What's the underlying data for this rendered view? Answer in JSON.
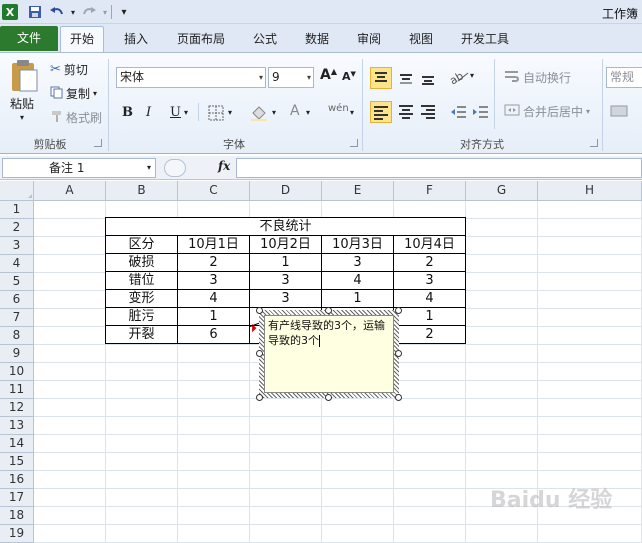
{
  "window": {
    "title": "工作簿"
  },
  "tabs": [
    "文件",
    "开始",
    "插入",
    "页面布局",
    "公式",
    "数据",
    "审阅",
    "视图",
    "开发工具"
  ],
  "ribbon": {
    "clipboard": {
      "paste": "粘贴",
      "cut": "剪切",
      "copy": "复制",
      "format_painter": "格式刷",
      "label": "剪贴板"
    },
    "font": {
      "name": "宋体",
      "size": "9",
      "bold": "B",
      "italic": "I",
      "underline": "U",
      "label": "字体",
      "grow": "A",
      "shrink": "A"
    },
    "alignment": {
      "wrap": "自动换行",
      "merge": "合并后居中",
      "label": "对齐方式"
    },
    "number": {
      "format": "常规"
    }
  },
  "formula_bar": {
    "name_box": "备注 1",
    "fx": "fx",
    "value": ""
  },
  "columns": [
    "A",
    "B",
    "C",
    "D",
    "E",
    "F",
    "G",
    "H"
  ],
  "rows": [
    "1",
    "2",
    "3",
    "4",
    "5",
    "6",
    "7",
    "8",
    "9",
    "10",
    "11",
    "12",
    "13",
    "14",
    "15",
    "16",
    "17",
    "18",
    "19"
  ],
  "table": {
    "title": "不良统计",
    "header": [
      "区分",
      "10月1日",
      "10月2日",
      "10月3日",
      "10月4日"
    ],
    "rows": [
      [
        "破损",
        "2",
        "1",
        "3",
        "2"
      ],
      [
        "错位",
        "3",
        "3",
        "4",
        "3"
      ],
      [
        "变形",
        "4",
        "3",
        "1",
        "4"
      ],
      [
        "脏污",
        "1",
        "",
        "",
        "1"
      ],
      [
        "开裂",
        "6",
        "",
        "",
        "2"
      ]
    ]
  },
  "comment": {
    "text": "有产线导致的3个，运输导致的3个"
  },
  "colors": {
    "file_tab": "#2b7a2e",
    "comment_bg": "#ffffe1",
    "highlight": "#fde38a",
    "comment_marker": "#e00000"
  }
}
